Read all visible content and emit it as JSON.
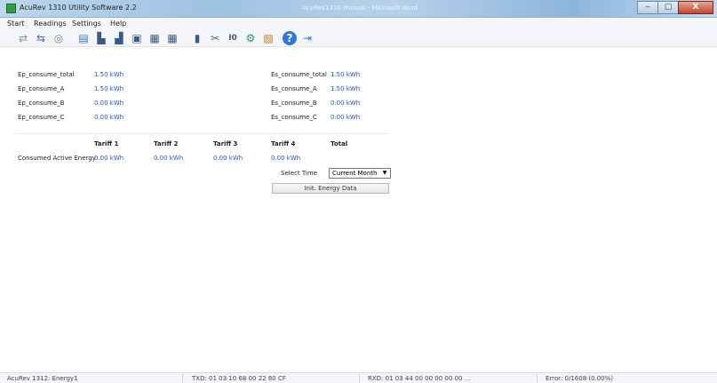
{
  "window": {
    "title": "AcuRev 1310 Utility Software 2.2",
    "bg_title": "AcuRev1310 Manual - Microsoft Word",
    "minimize": "‒",
    "maximize": "▢",
    "close": "X"
  },
  "menu": [
    "Start",
    "Readings",
    "Settings",
    "Help"
  ],
  "toolbar_icons": [
    "connect-icon",
    "disconnect-icon",
    "search-device-icon",
    "realtime-chart-icon",
    "energy-icon",
    "demand-icon",
    "record-icon",
    "calendar-icon",
    "schedule-icon",
    "device-icon",
    "tools-icon",
    "io-icon",
    "gear-io-icon",
    "image-icon",
    "help-icon",
    "exit-icon"
  ],
  "energy": {
    "left": [
      {
        "label": "Ep_consume_total",
        "value": "1.50 kWh"
      },
      {
        "label": "Ep_consume_A",
        "value": "1.50 kWh"
      },
      {
        "label": "Ep_consume_B",
        "value": "0.00 kWh"
      },
      {
        "label": "Ep_consume_C",
        "value": "0.00 kWh"
      }
    ],
    "right": [
      {
        "label": "Es_consume_total",
        "value": "1.50 kWh"
      },
      {
        "label": "Es_consume_A",
        "value": "1.50 kWh"
      },
      {
        "label": "Es_consume_B",
        "value": "0.00 kWh"
      },
      {
        "label": "Es_consume_C",
        "value": "0.00 kWh"
      }
    ]
  },
  "tariff": {
    "headers": [
      "Tariff 1",
      "Tariff 2",
      "Tariff 3",
      "Tariff 4",
      "Total"
    ],
    "row_label": "Consumed Active Energy",
    "values": [
      "0.00 kWh",
      "0.00 kWh",
      "0.00 kWh",
      "0.00 kWh"
    ]
  },
  "controls": {
    "select_time_label": "Select Time",
    "select_time_value": "Current Month",
    "init_button": "Init. Energy Data"
  },
  "status": {
    "device": "AcuRev 1312: Energy1",
    "txd": "TXD:  01 03 10 68 00 22 80 CF",
    "rxd": "RXD:  01 03 44 00 00 00 00 00 ...",
    "error": "Error:  0/1608  (0.00%)"
  }
}
